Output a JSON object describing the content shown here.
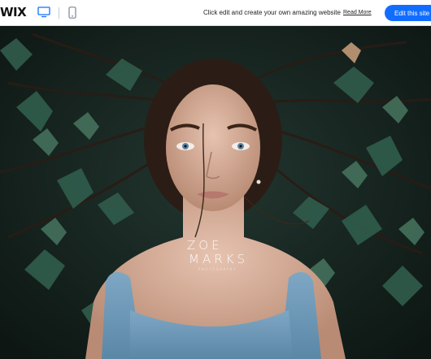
{
  "header": {
    "logo_text": "WIX",
    "promo_text": "Click edit and create your own amazing website",
    "read_more_label": "Read More",
    "edit_button_label": "Edit this site",
    "accent_color": "#116dff"
  },
  "hero": {
    "brand_line1": "ZOE",
    "brand_line2": "MARKS",
    "brand_line3": "PHOTOGRAPHY"
  }
}
